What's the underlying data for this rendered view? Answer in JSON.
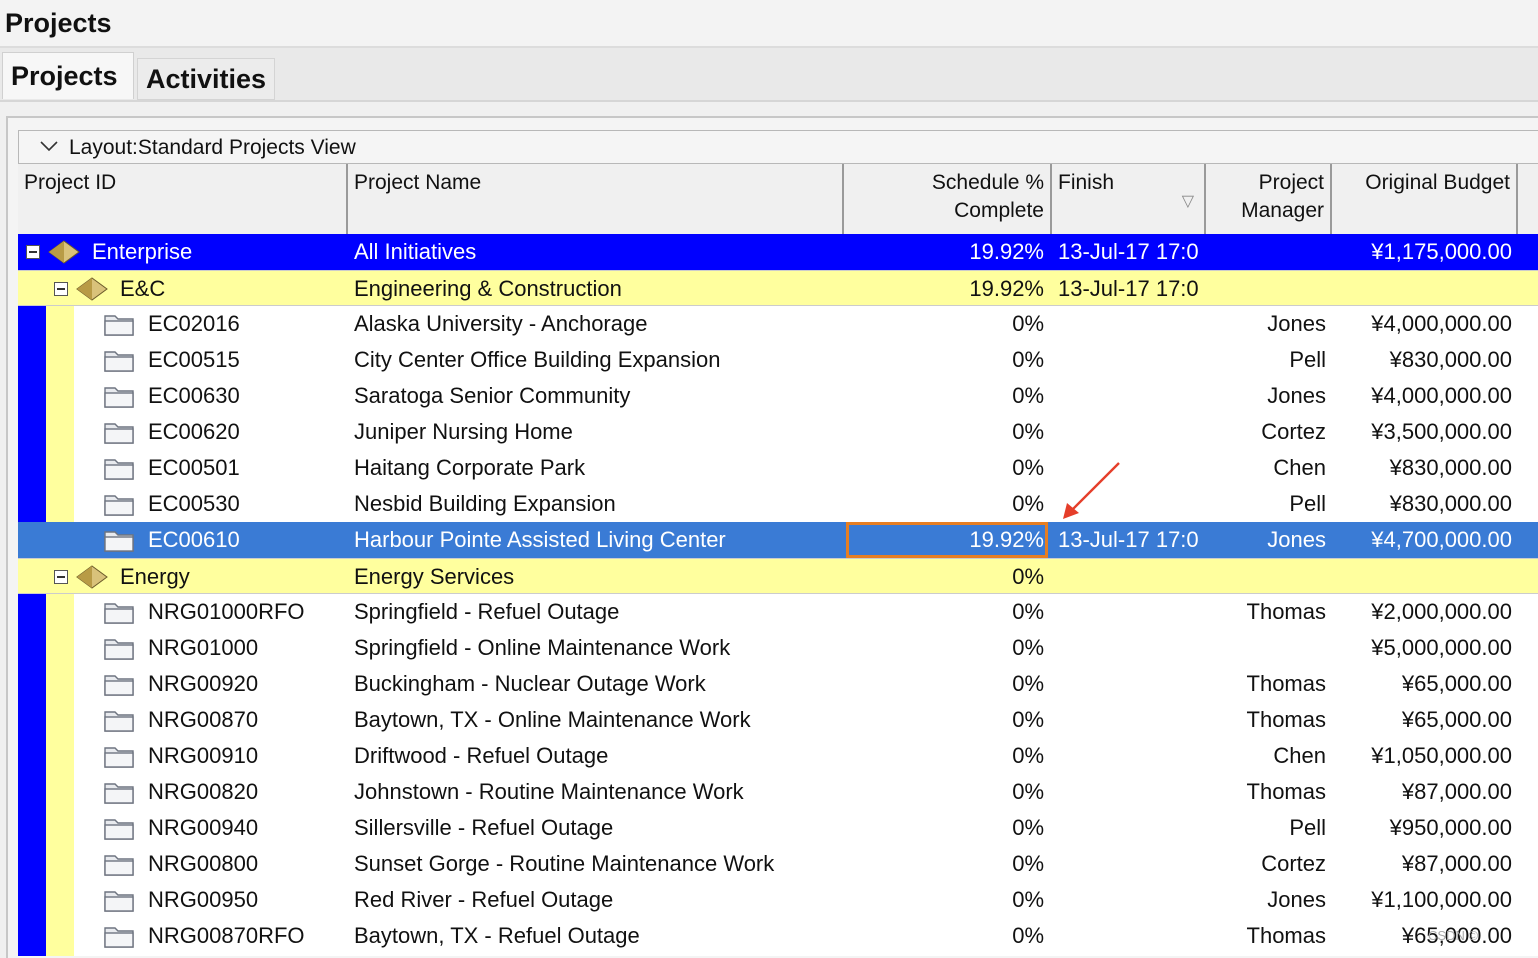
{
  "window": {
    "title": "Projects"
  },
  "tabs": [
    {
      "label": "Projects",
      "active": true
    },
    {
      "label": "Activities",
      "active": false
    }
  ],
  "layout": {
    "label": "Layout:Standard Projects View"
  },
  "columns": {
    "project_id": "Project ID",
    "project_name": "Project Name",
    "schedule_pct": [
      "Schedule %",
      "Complete"
    ],
    "finish": "Finish",
    "project_manager": [
      "Project",
      "Manager"
    ],
    "original_budget": "Original Budget"
  },
  "colors": {
    "enterprise_row": "#0000ff",
    "group_row": "#ffff9e",
    "selected_row": "#3a7bd5",
    "focused_cell_border": "#e67e22",
    "annotation_arrow": "#e53e2a"
  },
  "rows": [
    {
      "kind": "enterprise",
      "id": "Enterprise",
      "name": "All  Initiatives",
      "pct": "19.92%",
      "finish": "13-Jul-17 17:0(",
      "manager": "",
      "budget": "¥1,175,000.00",
      "icon": "eps-icon"
    },
    {
      "kind": "group",
      "id": "E&C",
      "name": "Engineering & Construction",
      "pct": "19.92%",
      "finish": "13-Jul-17 17:0(",
      "manager": "",
      "budget": "",
      "icon": "eps-icon"
    },
    {
      "kind": "project",
      "id": "EC02016",
      "name": "Alaska University - Anchorage",
      "pct": "0%",
      "finish": "",
      "manager": "Jones",
      "budget": "¥4,000,000.00",
      "icon": "folder-icon"
    },
    {
      "kind": "project",
      "id": "EC00515",
      "name": "City Center Office Building Expansion",
      "pct": "0%",
      "finish": "",
      "manager": "Pell",
      "budget": "¥830,000.00",
      "icon": "folder-icon"
    },
    {
      "kind": "project",
      "id": "EC00630",
      "name": "Saratoga Senior Community",
      "pct": "0%",
      "finish": "",
      "manager": "Jones",
      "budget": "¥4,000,000.00",
      "icon": "folder-icon"
    },
    {
      "kind": "project",
      "id": "EC00620",
      "name": "Juniper Nursing Home",
      "pct": "0%",
      "finish": "",
      "manager": "Cortez",
      "budget": "¥3,500,000.00",
      "icon": "folder-icon"
    },
    {
      "kind": "project",
      "id": "EC00501",
      "name": "Haitang Corporate Park",
      "pct": "0%",
      "finish": "",
      "manager": "Chen",
      "budget": "¥830,000.00",
      "icon": "folder-icon"
    },
    {
      "kind": "project",
      "id": "EC00530",
      "name": "Nesbid Building Expansion",
      "pct": "0%",
      "finish": "",
      "manager": "Pell",
      "budget": "¥830,000.00",
      "icon": "folder-icon"
    },
    {
      "kind": "selected",
      "id": "EC00610",
      "name": "Harbour Pointe Assisted Living Center",
      "pct": "19.92%",
      "finish": "13-Jul-17 17:0(",
      "manager": "Jones",
      "budget": "¥4,700,000.00",
      "icon": "folder-icon"
    },
    {
      "kind": "group",
      "id": "Energy",
      "name": "Energy Services",
      "pct": "0%",
      "finish": "",
      "manager": "",
      "budget": "",
      "icon": "eps-icon"
    },
    {
      "kind": "project",
      "id": "NRG01000RFO",
      "name": "Springfield - Refuel Outage",
      "pct": "0%",
      "finish": "",
      "manager": "Thomas",
      "budget": "¥2,000,000.00",
      "icon": "folder-icon"
    },
    {
      "kind": "project",
      "id": "NRG01000",
      "name": "Springfield - Online Maintenance Work",
      "pct": "0%",
      "finish": "",
      "manager": "",
      "budget": "¥5,000,000.00",
      "icon": "folder-icon"
    },
    {
      "kind": "project",
      "id": "NRG00920",
      "name": "Buckingham - Nuclear Outage Work",
      "pct": "0%",
      "finish": "",
      "manager": "Thomas",
      "budget": "¥65,000.00",
      "icon": "folder-icon"
    },
    {
      "kind": "project",
      "id": "NRG00870",
      "name": "Baytown, TX - Online Maintenance Work",
      "pct": "0%",
      "finish": "",
      "manager": "Thomas",
      "budget": "¥65,000.00",
      "icon": "folder-icon"
    },
    {
      "kind": "project",
      "id": "NRG00910",
      "name": "Driftwood - Refuel Outage",
      "pct": "0%",
      "finish": "",
      "manager": "Chen",
      "budget": "¥1,050,000.00",
      "icon": "folder-icon"
    },
    {
      "kind": "project",
      "id": "NRG00820",
      "name": "Johnstown - Routine Maintenance Work",
      "pct": "0%",
      "finish": "",
      "manager": "Thomas",
      "budget": "¥87,000.00",
      "icon": "folder-icon"
    },
    {
      "kind": "project",
      "id": "NRG00940",
      "name": "Sillersville - Refuel Outage",
      "pct": "0%",
      "finish": "",
      "manager": "Pell",
      "budget": "¥950,000.00",
      "icon": "folder-icon"
    },
    {
      "kind": "project",
      "id": "NRG00800",
      "name": "Sunset Gorge - Routine Maintenance Work",
      "pct": "0%",
      "finish": "",
      "manager": "Cortez",
      "budget": "¥87,000.00",
      "icon": "folder-icon"
    },
    {
      "kind": "project",
      "id": "NRG00950",
      "name": "Red River - Refuel Outage",
      "pct": "0%",
      "finish": "",
      "manager": "Jones",
      "budget": "¥1,100,000.00",
      "icon": "folder-icon"
    },
    {
      "kind": "project",
      "id": "NRG00870RFO",
      "name": "Baytown, TX - Refuel Outage",
      "pct": "0%",
      "finish": "",
      "manager": "Thomas",
      "budget": "¥65,000.00",
      "icon": "folder-icon"
    }
  ]
}
